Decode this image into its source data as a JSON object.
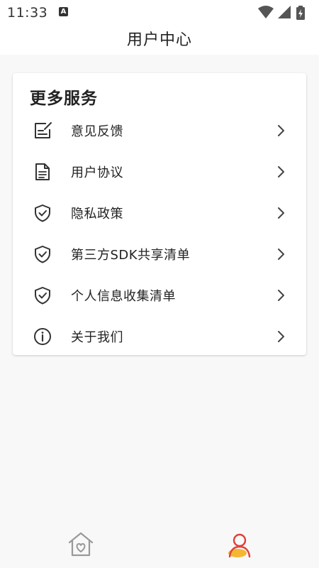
{
  "status_bar": {
    "time": "11:33",
    "notification_icon_letter": "A",
    "icons": [
      "wifi-icon",
      "signal-icon",
      "battery-charging-icon"
    ]
  },
  "header": {
    "title": "用户中心"
  },
  "services": {
    "title": "更多服务",
    "items": [
      {
        "label": "意见反馈",
        "icon": "feedback-edit-icon"
      },
      {
        "label": "用户协议",
        "icon": "document-icon"
      },
      {
        "label": "隐私政策",
        "icon": "shield-check-icon"
      },
      {
        "label": "第三方SDK共享清单",
        "icon": "shield-check-icon"
      },
      {
        "label": "个人信息收集清单",
        "icon": "shield-check-icon"
      },
      {
        "label": "关于我们",
        "icon": "info-icon"
      }
    ]
  },
  "bottom_nav": {
    "tabs": [
      {
        "icon": "home-heart-icon",
        "active": false
      },
      {
        "icon": "user-profile-icon",
        "active": true
      }
    ],
    "colors": {
      "inactive": "#999999",
      "active_outline": "#e0403a",
      "active_fill": "#f5b731"
    }
  }
}
